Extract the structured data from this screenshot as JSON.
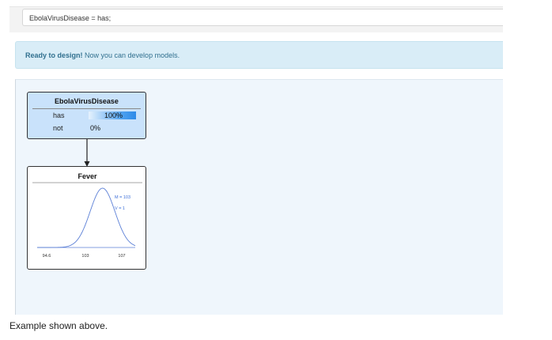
{
  "evidence": {
    "text": "EbolaVirusDisease = has;"
  },
  "alert": {
    "strong": "Ready to design!",
    "message": " Now you can develop models."
  },
  "nodes": {
    "disease": {
      "title": "EbolaVirusDisease",
      "states": [
        {
          "name": "has",
          "value": "100%",
          "probability": 1.0
        },
        {
          "name": "not",
          "value": "0%",
          "probability": 0.0
        }
      ]
    },
    "fever": {
      "title": "Fever",
      "mean_label": "M = 103",
      "variance_label": "V = 1",
      "x_ticks": [
        "94.6",
        "103",
        "107"
      ]
    }
  },
  "chart_data": {
    "type": "line",
    "title": "Fever",
    "mean": 103,
    "variance": 1,
    "x_ticks": [
      94.6,
      103,
      107
    ],
    "xlim": [
      93,
      108
    ],
    "annotations": [
      "M = 103",
      "V = 1"
    ]
  },
  "footer": {
    "caption": "Example shown above."
  },
  "colors": {
    "curve": "#5b7fd6",
    "annotation": "#3d6fd8",
    "node_fill": "#c9e2fb",
    "alert_bg": "#d9edf7"
  }
}
